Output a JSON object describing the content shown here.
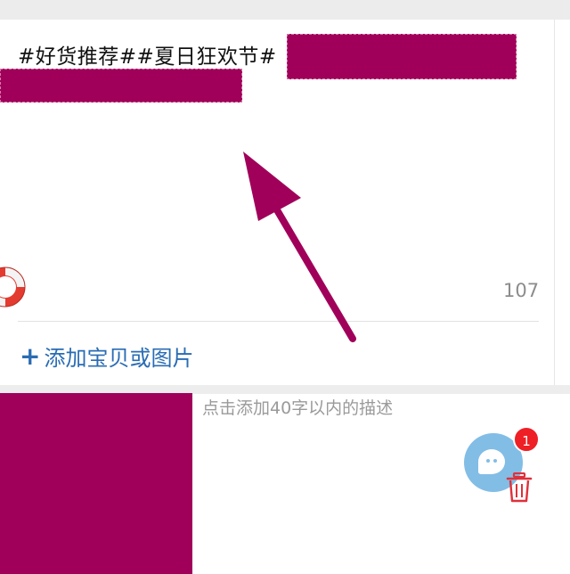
{
  "post": {
    "text": "#好货推荐##夏日狂欢节#",
    "char_count": "107"
  },
  "actions": {
    "add_label": "添加宝贝或图片",
    "add_plus": "+"
  },
  "description": {
    "placeholder": "点击添加40字以内的描述"
  },
  "floating": {
    "badge_count": "1"
  },
  "icons": [
    "lifebuoy-icon",
    "chat-icon",
    "trash-icon",
    "plus-icon"
  ],
  "colors": {
    "accent_blue": "#2a6cb4",
    "redaction": "#a0005a",
    "badge_red": "#ee1f25",
    "float_blue": "#82bde6"
  }
}
